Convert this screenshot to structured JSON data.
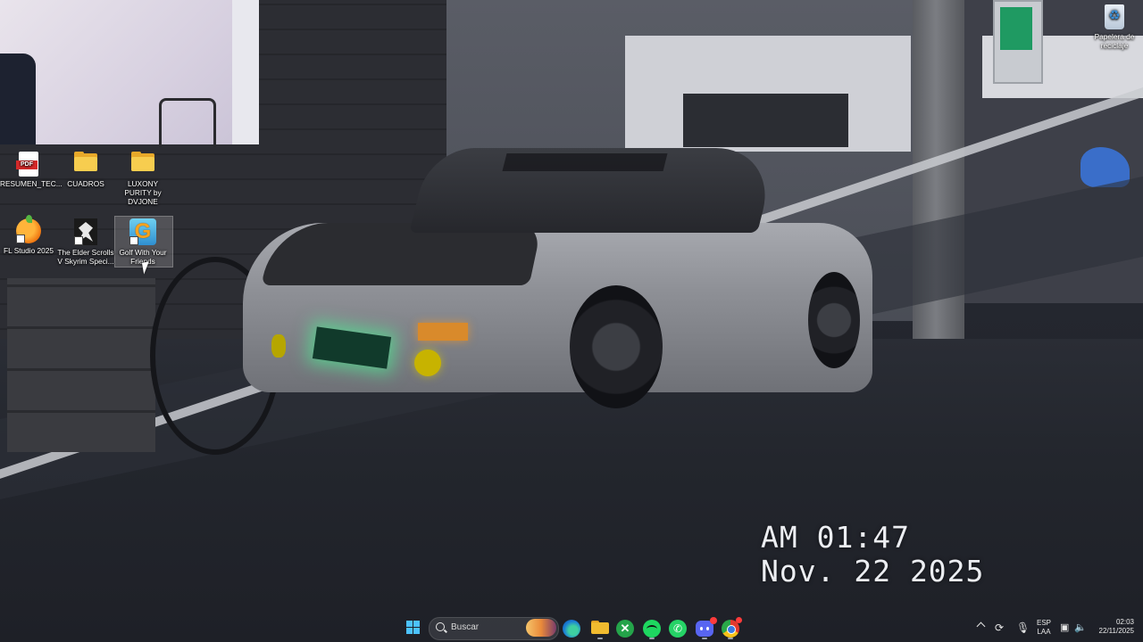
{
  "desktop": {
    "icons": [
      {
        "label": "RESUMEN_TEC...",
        "icon": "pdf-file-icon"
      },
      {
        "label": "CUADROS",
        "icon": "folder-icon"
      },
      {
        "label": "LUXONY PURITY by DVJONE",
        "icon": "folder-icon"
      },
      {
        "label": "FL Studio 2025",
        "icon": "fl-studio-icon"
      },
      {
        "label": "The Elder Scrolls V Skyrim Speci...",
        "icon": "skyrim-icon"
      },
      {
        "label": "Golf With Your Friends",
        "icon": "golf-with-your-friends-icon"
      },
      {
        "label": "Papelera de reciclaje",
        "icon": "recycle-bin-icon"
      }
    ],
    "pdf_tag": "PDF",
    "golf_letter": "G"
  },
  "clock_widget": {
    "time": "AM 01:47",
    "date": "Nov. 22 2025"
  },
  "taskbar": {
    "search_placeholder": "Buscar",
    "apps": [
      "start-icon",
      "edge-icon",
      "file-explorer-icon",
      "xbox-icon",
      "spotify-icon",
      "whatsapp-icon",
      "discord-icon",
      "chrome-icon"
    ],
    "tray": {
      "language_line1": "ESP",
      "language_line2": "LAA",
      "time": "02:03",
      "date": "22/11/2025"
    }
  },
  "colors": {
    "accent": "#4cc2ff",
    "folder": "#f7cd4f",
    "plate_glow": "#46ff96"
  }
}
